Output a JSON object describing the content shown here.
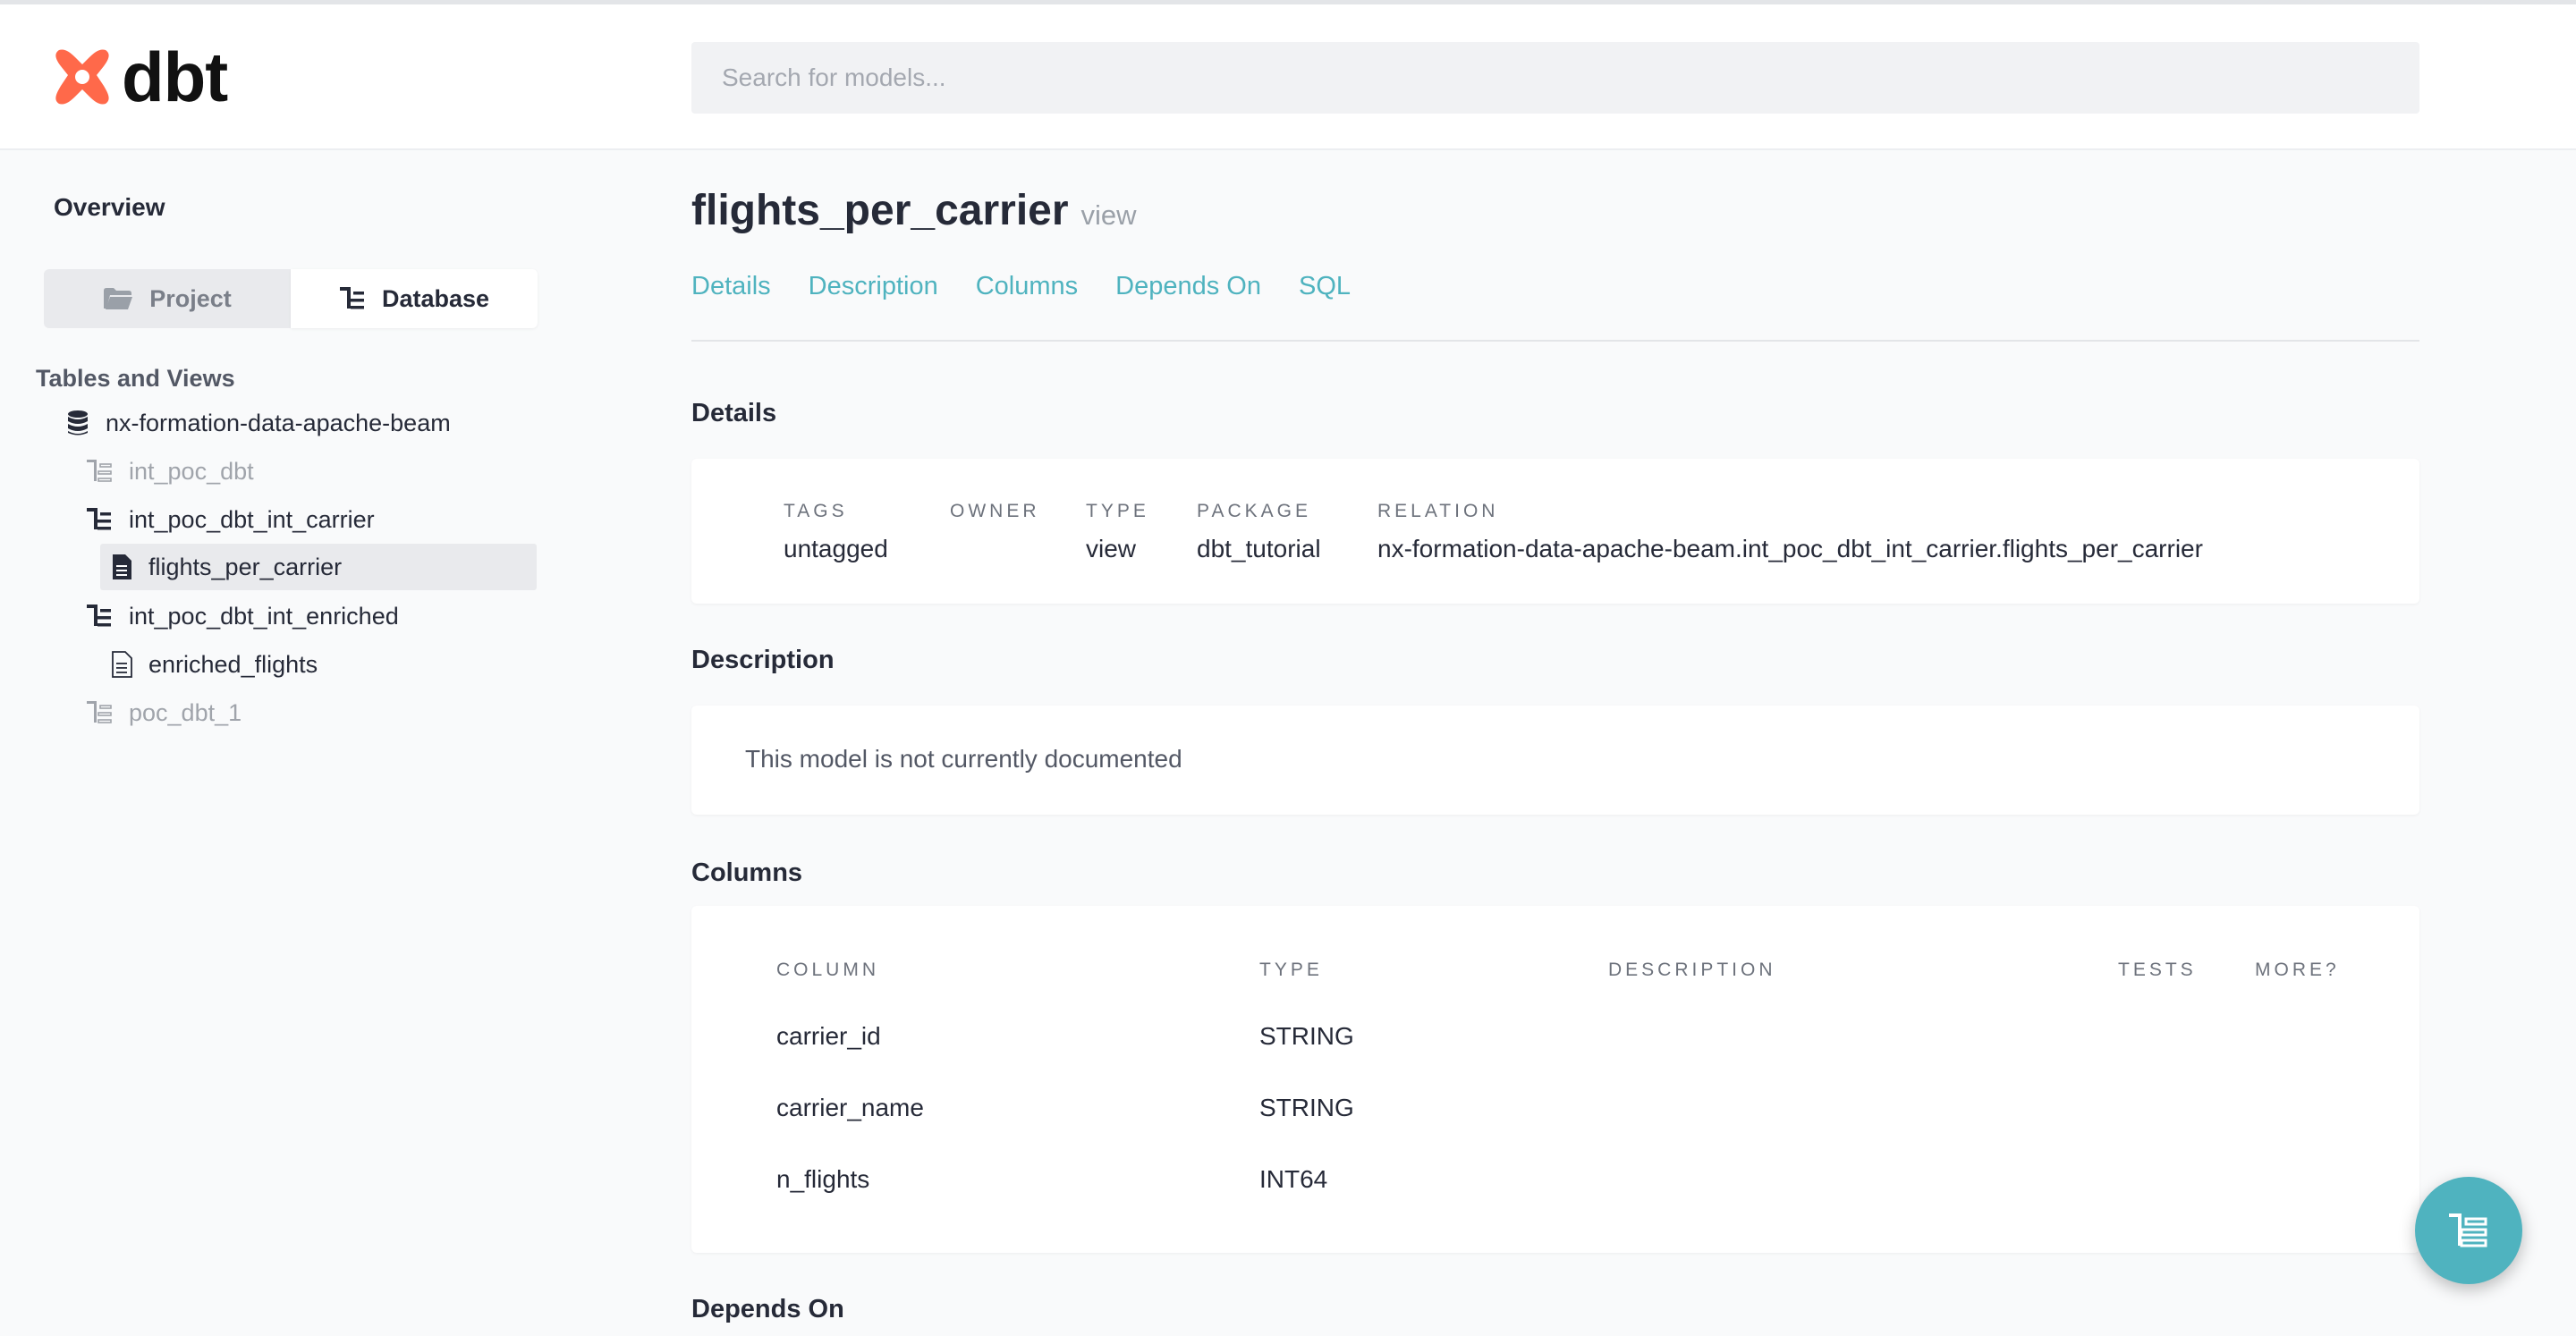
{
  "brand": {
    "name": "dbt",
    "color": "#ff694a"
  },
  "search": {
    "placeholder": "Search for models...",
    "value": ""
  },
  "sidebar": {
    "overview_label": "Overview",
    "switcher": {
      "project_label": "Project",
      "database_label": "Database",
      "active": "Database"
    },
    "section_title": "Tables and Views",
    "tree": [
      {
        "label": "nx-formation-data-apache-beam",
        "icon": "database-icon",
        "level": 0,
        "muted": false,
        "selected": false
      },
      {
        "label": "int_poc_dbt",
        "icon": "schema-tree-icon",
        "level": 1,
        "muted": true,
        "selected": false
      },
      {
        "label": "int_poc_dbt_int_carrier",
        "icon": "schema-tree-icon",
        "level": 1,
        "muted": false,
        "selected": false
      },
      {
        "label": "flights_per_carrier",
        "icon": "document-filled-icon",
        "level": 2,
        "muted": false,
        "selected": true
      },
      {
        "label": "int_poc_dbt_int_enriched",
        "icon": "schema-tree-icon",
        "level": 1,
        "muted": false,
        "selected": false
      },
      {
        "label": "enriched_flights",
        "icon": "document-outline-icon",
        "level": 2,
        "muted": false,
        "selected": false
      },
      {
        "label": "poc_dbt_1",
        "icon": "schema-tree-icon",
        "level": 1,
        "muted": true,
        "selected": false
      }
    ]
  },
  "model": {
    "name": "flights_per_carrier",
    "kind": "view"
  },
  "tabs": [
    "Details",
    "Description",
    "Columns",
    "Depends On",
    "SQL"
  ],
  "details": {
    "heading": "Details",
    "items": [
      {
        "label": "TAGS",
        "value": "untagged"
      },
      {
        "label": "OWNER",
        "value": ""
      },
      {
        "label": "TYPE",
        "value": "view"
      },
      {
        "label": "PACKAGE",
        "value": "dbt_tutorial"
      },
      {
        "label": "RELATION",
        "value": "nx-formation-data-apache-beam.int_poc_dbt_int_carrier.flights_per_carrier"
      }
    ]
  },
  "description": {
    "heading": "Description",
    "text": "This model is not currently documented"
  },
  "columns": {
    "heading": "Columns",
    "headers": [
      "COLUMN",
      "TYPE",
      "DESCRIPTION",
      "TESTS",
      "MORE?"
    ],
    "rows": [
      {
        "column": "carrier_id",
        "type": "STRING",
        "description": "",
        "tests": ""
      },
      {
        "column": "carrier_name",
        "type": "STRING",
        "description": "",
        "tests": ""
      },
      {
        "column": "n_flights",
        "type": "INT64",
        "description": "",
        "tests": ""
      }
    ]
  },
  "depends_on": {
    "heading": "Depends On"
  },
  "fab": {
    "icon": "lineage-graph-icon",
    "color": "#4fb3bf"
  }
}
